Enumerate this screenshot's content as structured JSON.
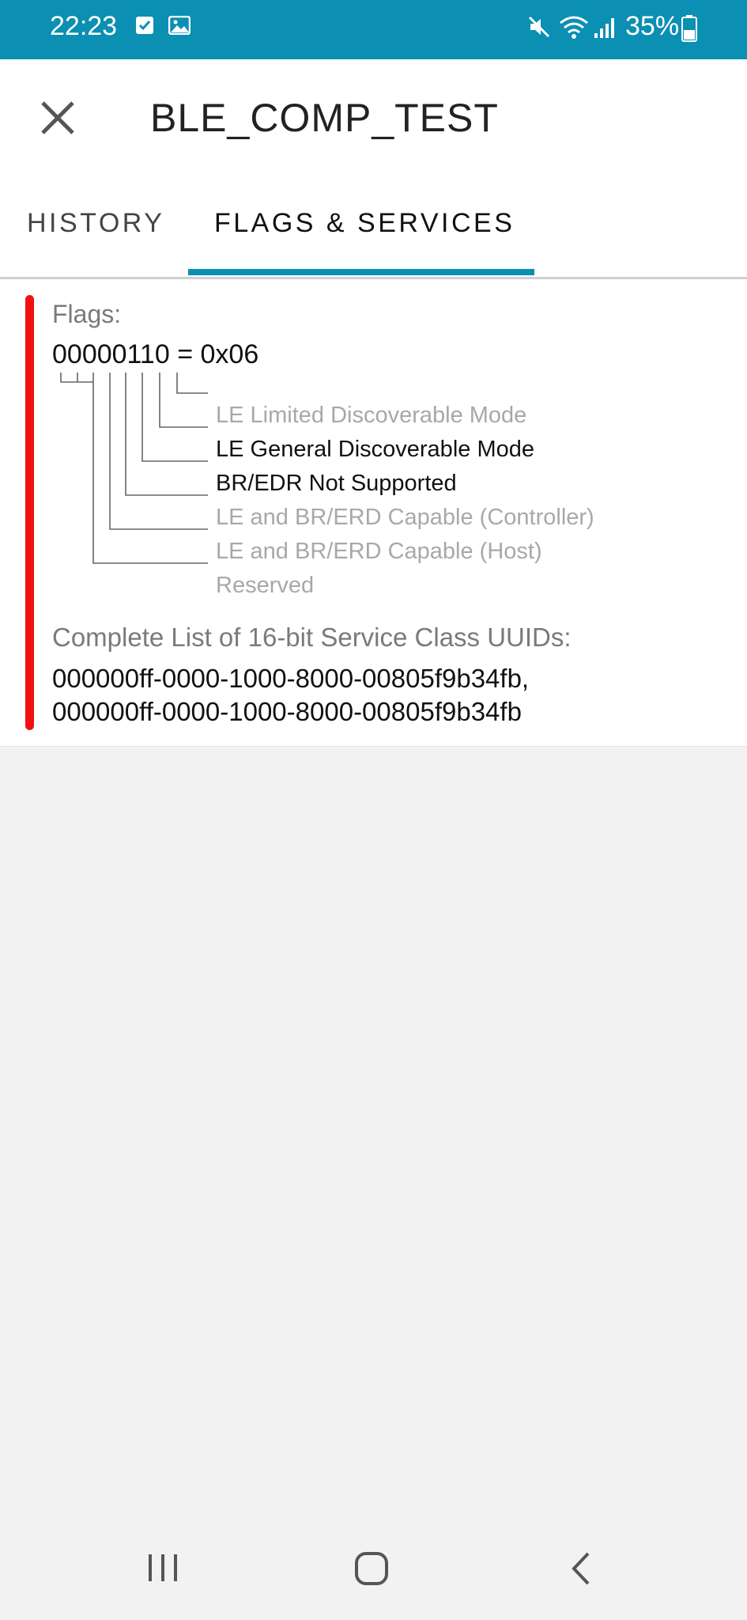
{
  "status_bar": {
    "time": "22:23",
    "battery": "35%",
    "icons": [
      "checkbox-notification-icon",
      "image-notification-icon",
      "mute-icon",
      "wifi-icon",
      "signal-icon",
      "battery-icon"
    ]
  },
  "app_bar": {
    "title": "BLE_COMP_TEST",
    "close_icon": "close-icon"
  },
  "tabs": [
    {
      "label": "HISTORY",
      "selected": false
    },
    {
      "label": "FLAGS & SERVICES",
      "selected": true
    }
  ],
  "accent_color": "#0b8fb2",
  "flags_card": {
    "indicator_color": "#f20f0f",
    "flags_label": "Flags:",
    "flags_value": "00000110 = 0x06",
    "bits": [
      {
        "label": "LE Limited Discoverable Mode",
        "active": false
      },
      {
        "label": "LE General Discoverable Mode",
        "active": true
      },
      {
        "label": "BR/EDR Not Supported",
        "active": true
      },
      {
        "label": "LE and BR/ERD Capable (Controller)",
        "active": false
      },
      {
        "label": "LE and BR/ERD Capable (Host)",
        "active": false
      },
      {
        "label": "Reserved",
        "active": false
      }
    ],
    "uuids_label": "Complete List of 16-bit Service Class UUIDs:",
    "uuids_value": "000000ff-0000-1000-8000-00805f9b34fb,\n000000ff-0000-1000-8000-00805f9b34fb"
  },
  "nav_bar": {
    "buttons": [
      "recent-apps-icon",
      "home-icon",
      "back-icon"
    ]
  }
}
